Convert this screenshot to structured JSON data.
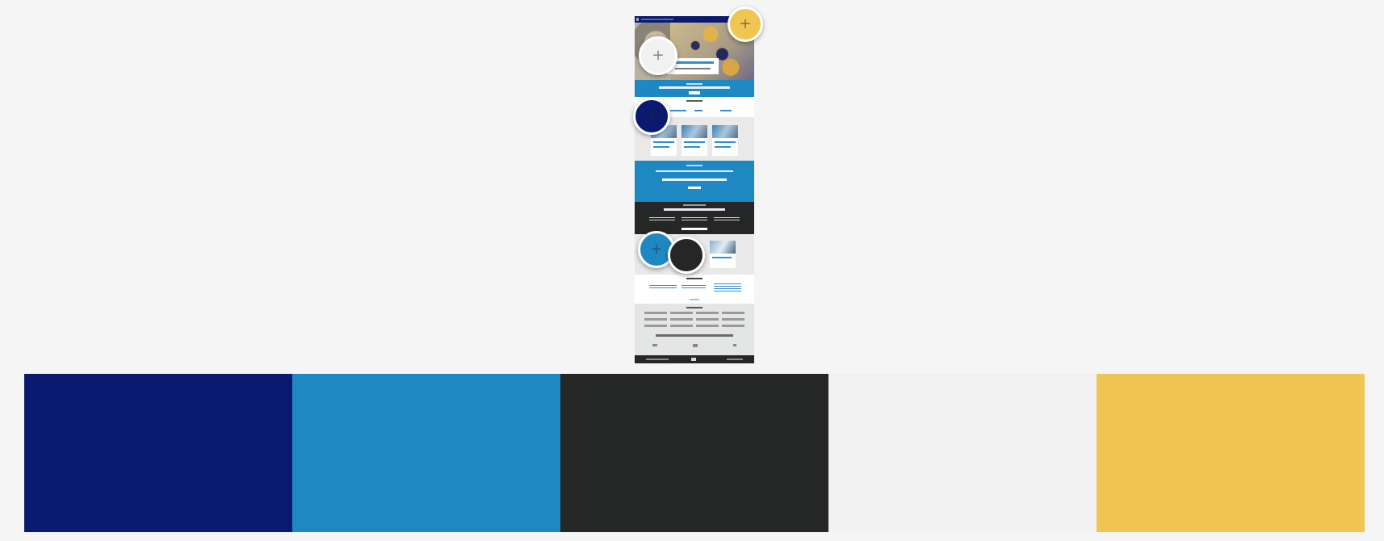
{
  "palette": {
    "swatches": [
      {
        "id": "navy",
        "hex": "#0a1a6e"
      },
      {
        "id": "blue",
        "hex": "#1e88c3"
      },
      {
        "id": "charcoal",
        "hex": "#252726"
      },
      {
        "id": "light-gray",
        "hex": "#f1f1f1"
      },
      {
        "id": "yellow",
        "hex": "#f0c552"
      }
    ]
  },
  "pickers": [
    {
      "id": "yellow",
      "hex": "#f0c552",
      "icon": "plus-icon",
      "glyph": "+"
    },
    {
      "id": "light-gray",
      "hex": "#f1f1f1",
      "icon": "plus-icon",
      "glyph": "+"
    },
    {
      "id": "navy",
      "hex": "#0a1a6e",
      "icon": "plus-icon",
      "glyph": "+"
    },
    {
      "id": "blue",
      "hex": "#1e88c3",
      "icon": "plus-icon",
      "glyph": "+"
    },
    {
      "id": "charcoal",
      "hex": "#252726",
      "icon": "plus-icon",
      "glyph": "+"
    }
  ]
}
